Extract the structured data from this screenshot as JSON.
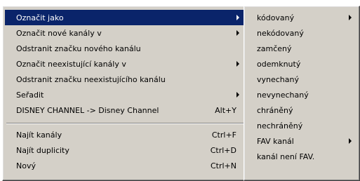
{
  "menu": {
    "items": [
      {
        "label": "Označit jako",
        "submenu": true,
        "selected": true
      },
      {
        "label": "Označit nové kanály v",
        "submenu": true
      },
      {
        "label": "Odstranit značku nového kanálu"
      },
      {
        "label": "Označit neexistující kanály v",
        "submenu": true
      },
      {
        "label": "Odstranit značku neexistujícího kanálu"
      },
      {
        "label": "Seřadit",
        "submenu": true
      },
      {
        "label": "DISNEY CHANNEL -> Disney Channel",
        "shortcut": "Alt+Y"
      },
      {
        "label": "Najít kanály",
        "shortcut": "Ctrl+F"
      },
      {
        "label": "Najít duplicity",
        "shortcut": "Ctrl+D"
      },
      {
        "label": "Nový",
        "shortcut": "Ctrl+N"
      }
    ]
  },
  "submenu": {
    "items": [
      {
        "label": "kódovaný",
        "submenu": true
      },
      {
        "label": "nekódovaný"
      },
      {
        "label": "zamčený"
      },
      {
        "label": "odemknutý"
      },
      {
        "label": "vynechaný"
      },
      {
        "label": "nevynechaný"
      },
      {
        "label": "chráněný"
      },
      {
        "label": "nechráněný"
      },
      {
        "label": "FAV kanál",
        "submenu": true
      },
      {
        "label": "kanál není FAV."
      }
    ]
  },
  "colors": {
    "menu_bg": "#d4d0c8",
    "highlight": "#0a246a",
    "highlight_text": "#ffffff"
  }
}
